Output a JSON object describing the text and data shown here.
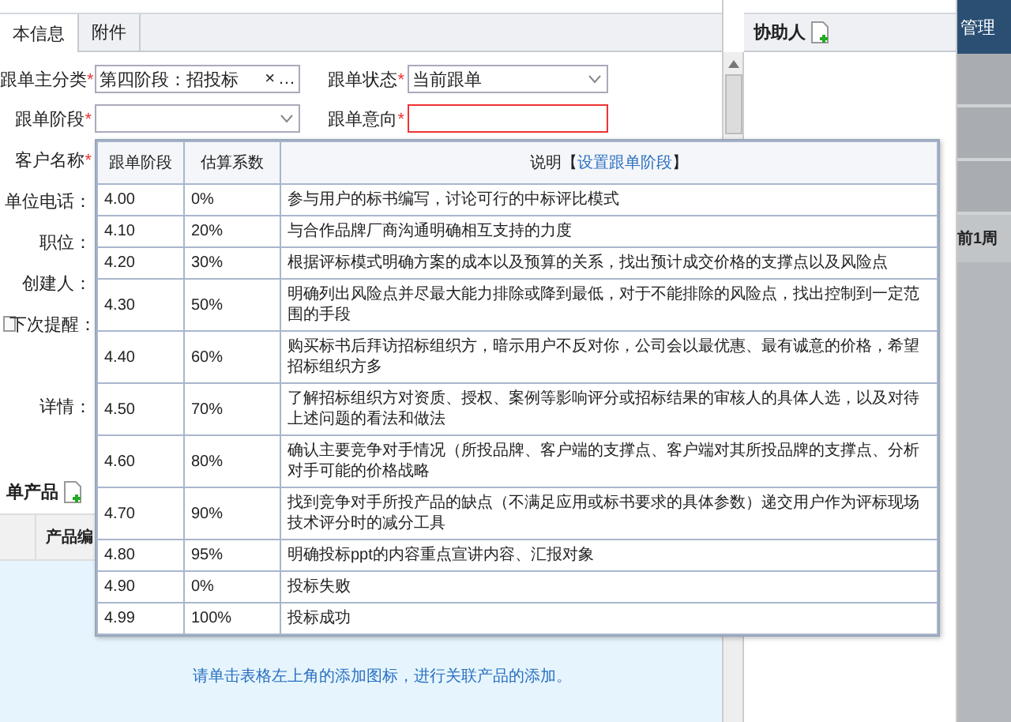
{
  "tabs": [
    {
      "label": "本信息",
      "selected": true
    },
    {
      "label": "附件",
      "selected": false
    }
  ],
  "top_fields": [
    {
      "label": "跟单主分类",
      "mark": "*",
      "kind": "lookup",
      "value": "第四阶段：招投标",
      "clear": "×",
      "more": "…"
    },
    {
      "label": "跟单状态",
      "mark": "*",
      "kind": "select",
      "value": "当前跟单"
    },
    {
      "label": "跟单阶段",
      "mark": "*",
      "kind": "select"
    },
    {
      "label": "跟单意向",
      "mark": "*",
      "kind": "text",
      "invalid": true
    }
  ],
  "labels": [
    {
      "text": "客户名称",
      "mark": "*",
      "kind": "plain"
    },
    {
      "text": "单位电话：",
      "kind": "plain"
    },
    {
      "text": "职位：",
      "kind": "plain"
    },
    {
      "text": "创建人：",
      "kind": "plain"
    },
    {
      "text": "下次提醒：",
      "kind": "checkbox",
      "checked": false
    },
    {
      "text": "详情：",
      "kind": "tall"
    }
  ],
  "products": {
    "title": "单产品",
    "columns": [
      "产品编"
    ],
    "hint": "请单击表格左上角的添加图标，进行关联产品的添加。"
  },
  "assist": {
    "title": "协助人"
  },
  "side": {
    "menu": "管理",
    "cell": "前1周"
  },
  "popup": {
    "columns": [
      "跟单阶段",
      "估算系数"
    ],
    "note_header": "说明【",
    "note_link": "设置跟单阶段",
    "note_end": "】",
    "rows": [
      {
        "stage": "4.00",
        "rate": "0%",
        "desc": "参与用户的标书编写，讨论可行的中标评比模式"
      },
      {
        "stage": "4.10",
        "rate": "20%",
        "desc": "与合作品牌厂商沟通明确相互支持的力度"
      },
      {
        "stage": "4.20",
        "rate": "30%",
        "desc": "根据评标模式明确方案的成本以及预算的关系，找出预计成交价格的支撑点以及风险点"
      },
      {
        "stage": "4.30",
        "rate": "50%",
        "desc": "明确列出风险点并尽最大能力排除或降到最低，对于不能排除的风险点，找出控制到一定范围的手段"
      },
      {
        "stage": "4.40",
        "rate": "60%",
        "desc": "购买标书后拜访招标组织方，暗示用户不反对你，公司会以最优惠、最有诚意的价格，希望招标组织方多"
      },
      {
        "stage": "4.50",
        "rate": "70%",
        "desc": "了解招标组织方对资质、授权、案例等影响评分或招标结果的审核人的具体人选，以及对待上述问题的看法和做法"
      },
      {
        "stage": "4.60",
        "rate": "80%",
        "desc": "确认主要竞争对手情况（所投品牌、客户端的支撑点、客户端对其所投品牌的支撑点、分析对手可能的价格战略"
      },
      {
        "stage": "4.70",
        "rate": "90%",
        "desc": "找到竞争对手所投产品的缺点（不满足应用或标书要求的具体参数）递交用户作为评标现场技术评分时的减分工具"
      },
      {
        "stage": "4.80",
        "rate": "95%",
        "desc": "明确投标ppt的内容重点宣讲内容、汇报对象"
      },
      {
        "stage": "4.90",
        "rate": "0%",
        "desc": "投标失败"
      },
      {
        "stage": "4.99",
        "rate": "100%",
        "desc": "投标成功"
      }
    ]
  }
}
